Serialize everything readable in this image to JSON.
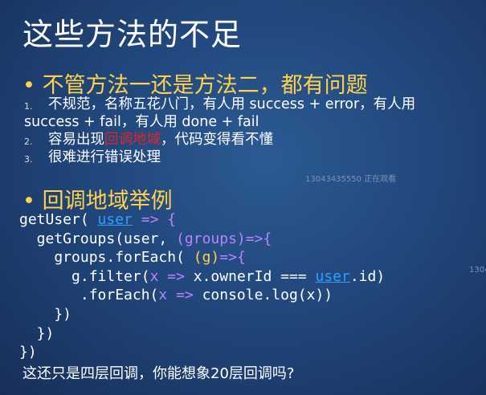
{
  "slide": {
    "title": "这些方法的不足",
    "bullet1": {
      "dot": "•",
      "text": "不管方法一还是方法二，都有问题"
    },
    "items": [
      {
        "num": "1.",
        "line1": "不规范，名称五花八门，有人用 success + error，有人用",
        "line2": "success + fail，有人用 done + fail"
      },
      {
        "num": "2.",
        "pre": "容易出现",
        "highlight": "回调地域",
        "post": "，代码变得看不懂"
      },
      {
        "num": "3.",
        "text": "很难进行错误处理"
      }
    ],
    "bullet2": {
      "dot": "•",
      "text": "回调地域举例"
    },
    "code": {
      "l1a": "getUser( ",
      "l1b": "user",
      "l1c": " =>",
      "l1d": " {",
      "l2a": "  getGroups(user, ",
      "l2b": "(groups)=>{",
      "l3a": "    groups.forEach( ",
      "l3b": "(g)",
      "l3c": "=>{",
      "l4a": "      g.filter(",
      "l4b": "x =>",
      "l4c": " x.ownerId === ",
      "l4d": "user",
      "l4e": ".id)",
      "l5a": "       .forEach(",
      "l5b": "x =>",
      "l5c": " console.log(x))",
      "l6": "    })",
      "l7": "  })",
      "l8": "})"
    },
    "footer": "这还只是四层回调，你能想象20层回调吗?",
    "watermark": "13043435550 正在观看",
    "watermark_right": "1304"
  },
  "colors": {
    "accent": "#ffd24a",
    "keyword": "#2f9fff",
    "arrow": "#b883ff",
    "highlight": "#e0242a"
  }
}
